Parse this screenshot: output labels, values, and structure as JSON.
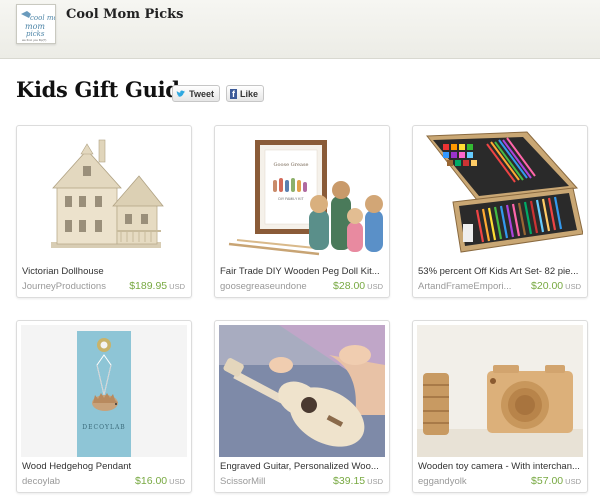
{
  "header": {
    "shop_name": "Cool Mom Picks",
    "avatar_text": "cool mom picks",
    "avatar_tagline": "we find. you flip(?)"
  },
  "page": {
    "title": "Kids Gift Guide",
    "tweet_label": "Tweet",
    "like_label": "Like"
  },
  "items": [
    {
      "title": "Victorian Dollhouse",
      "seller": "JourneyProductions",
      "price": "$189.95",
      "currency": "USD"
    },
    {
      "title": "Fair Trade DIY Wooden Peg Doll Kit...",
      "seller": "goosegreaseundone",
      "price": "$28.00",
      "currency": "USD"
    },
    {
      "title": "53% percent Off Kids Art Set- 82 pie...",
      "seller": "ArtandFrameEmpori...",
      "price": "$20.00",
      "currency": "USD"
    },
    {
      "title": "Wood Hedgehog Pendant",
      "seller": "decoylab",
      "price": "$16.00",
      "currency": "USD"
    },
    {
      "title": "Engraved Guitar, Personalized Woo...",
      "seller": "ScissorMill",
      "price": "$39.15",
      "currency": "USD"
    },
    {
      "title": "Wooden toy camera - With interchan...",
      "seller": "eggandyolk",
      "price": "$57.00",
      "currency": "USD"
    }
  ],
  "doll_kit_text": {
    "brand": "Goose Grease",
    "label": "DIY FAMILY KIT"
  },
  "pendant_text": {
    "brand": "DECOYLAB"
  },
  "icons": [
    "twitter-icon",
    "facebook-icon"
  ],
  "colors": {
    "price_green": "#78a942",
    "avatar_blue": "#4f86a8",
    "facebook_blue": "#3b5998",
    "twitter_blue": "#2fa8e0"
  }
}
